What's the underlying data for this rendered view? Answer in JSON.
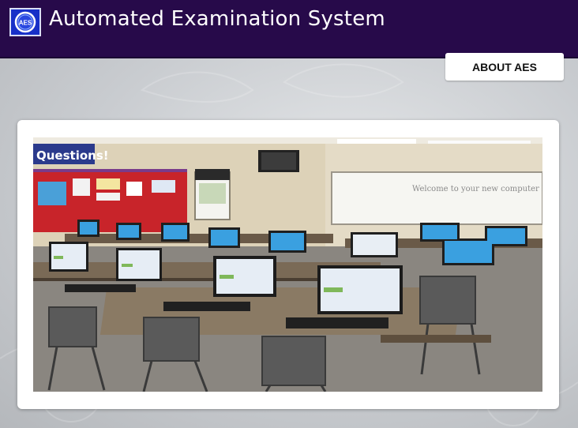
{
  "header": {
    "logo_text": "AES",
    "title": "Automated Examination System",
    "background_color": "#270a4a",
    "logo_color": "#1730c8"
  },
  "nav": {
    "about_label": "ABOUT AES"
  },
  "hero": {
    "image": "computer-lab-photo",
    "whiteboard_text": "Welcome to your new computer lab!",
    "banner_text": "Questions!"
  }
}
